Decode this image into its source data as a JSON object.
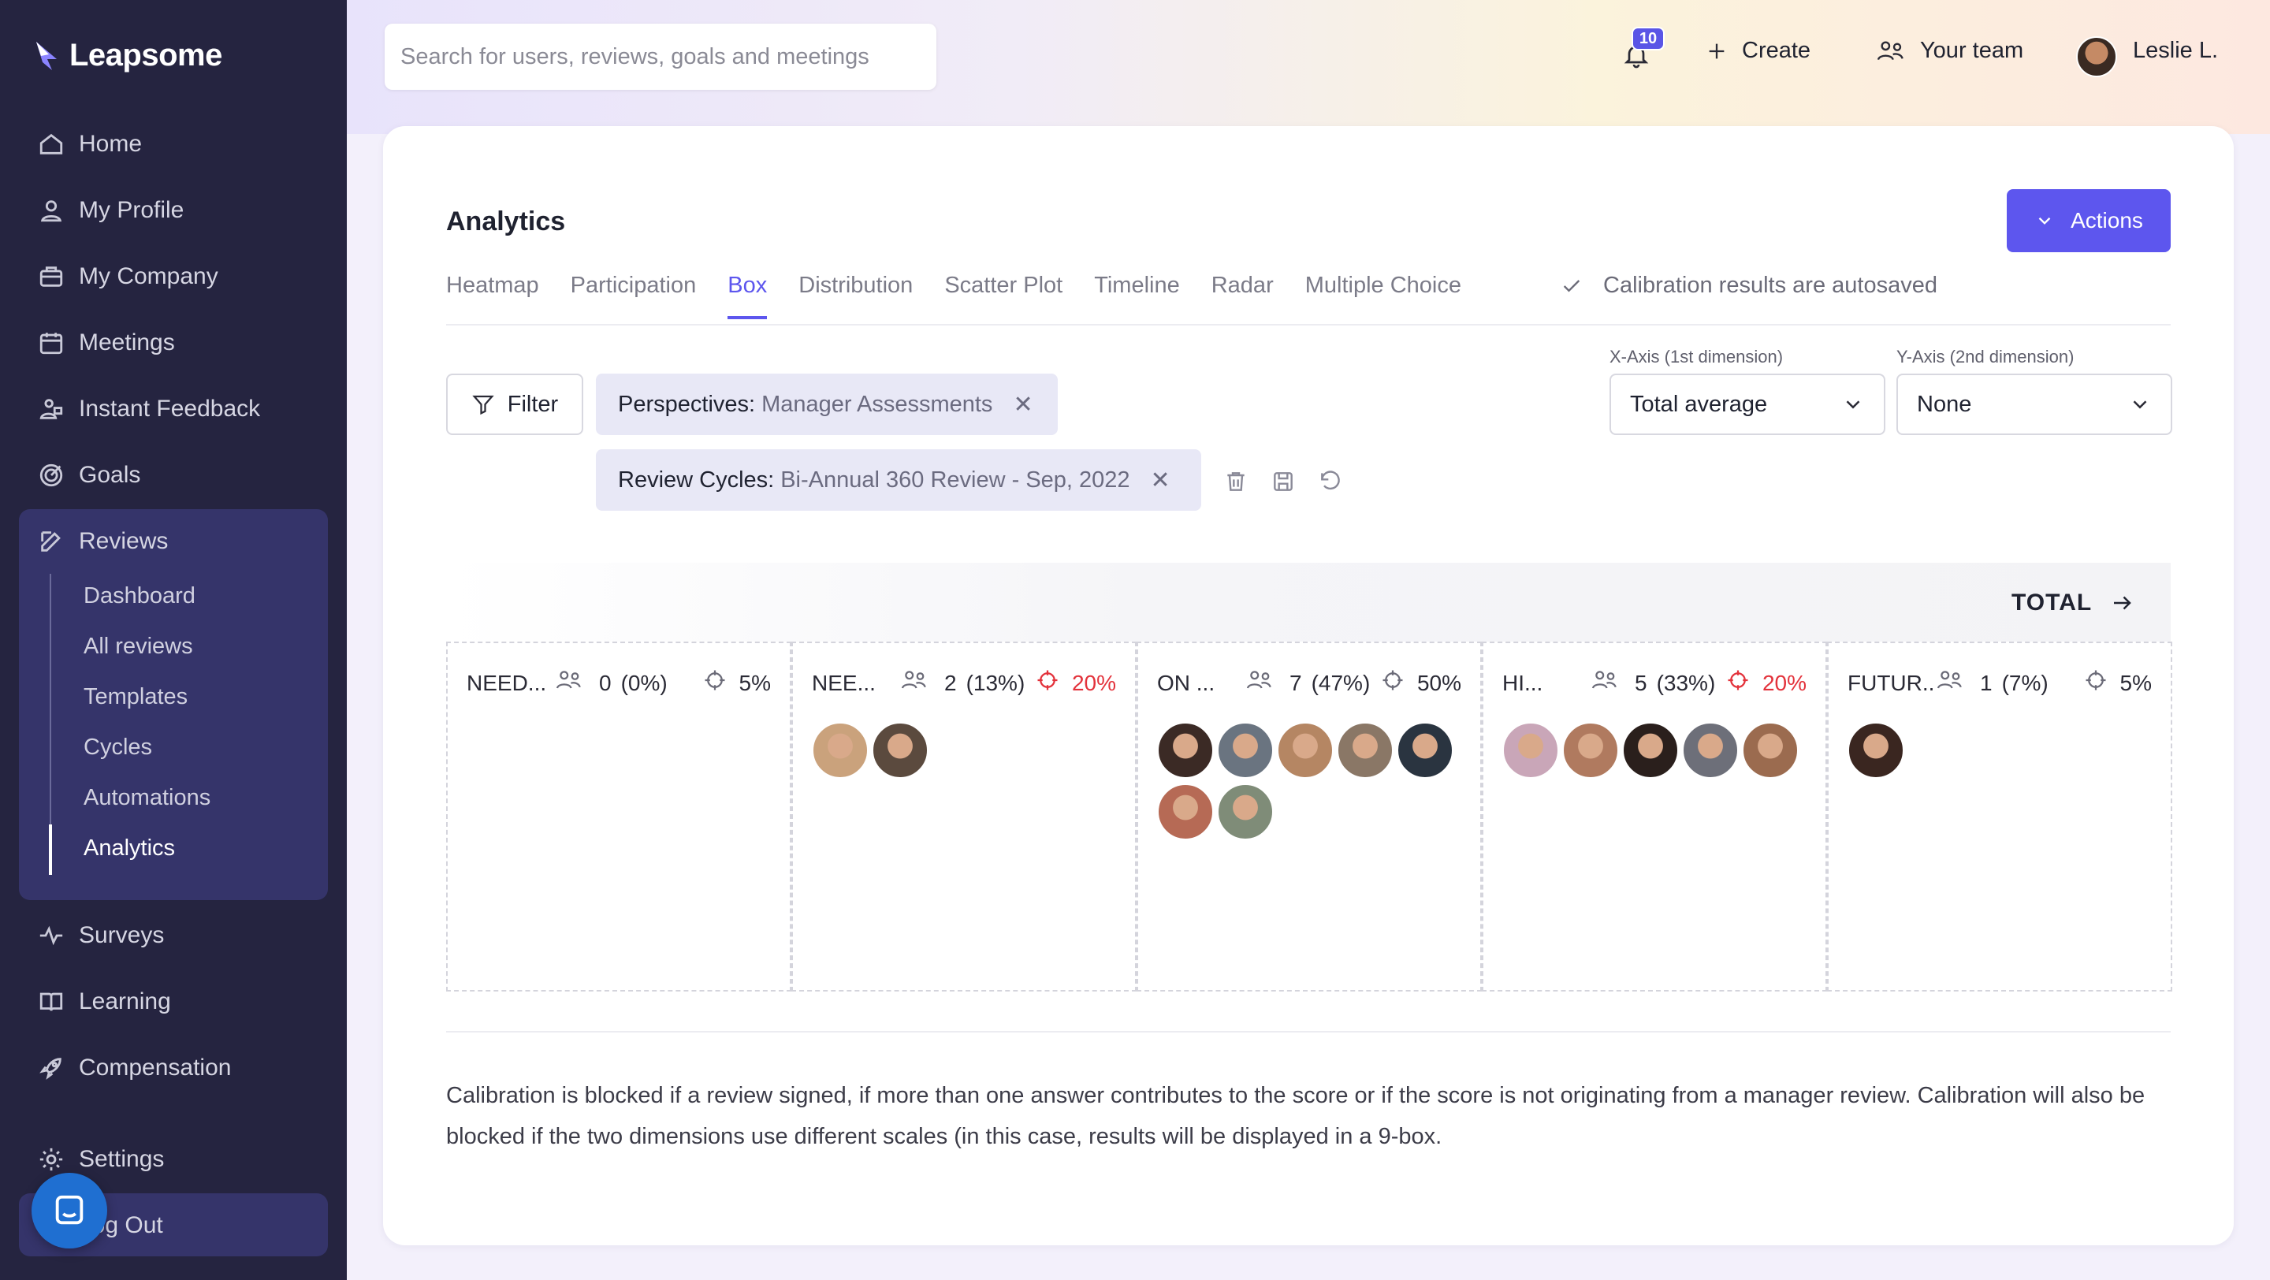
{
  "app": {
    "brand": "Leapsome"
  },
  "sidebar": {
    "items": [
      {
        "label": "Home",
        "icon": "home-icon"
      },
      {
        "label": "My Profile",
        "icon": "user-icon"
      },
      {
        "label": "My Company",
        "icon": "company-icon"
      },
      {
        "label": "Meetings",
        "icon": "calendar-icon"
      },
      {
        "label": "Instant Feedback",
        "icon": "feedback-icon"
      },
      {
        "label": "Goals",
        "icon": "target-icon"
      },
      {
        "label": "Reviews",
        "icon": "edit-icon"
      },
      {
        "label": "Surveys",
        "icon": "pulse-icon"
      },
      {
        "label": "Learning",
        "icon": "book-icon"
      },
      {
        "label": "Compensation",
        "icon": "rocket-icon"
      },
      {
        "label": "Settings",
        "icon": "gear-icon"
      },
      {
        "label": "Log Out",
        "icon": "logout-icon"
      }
    ],
    "reviews_sub": [
      "Dashboard",
      "All reviews",
      "Templates",
      "Cycles",
      "Automations",
      "Analytics"
    ],
    "active_sub": "Analytics"
  },
  "topbar": {
    "search_placeholder": "Search for users, reviews, goals and meetings",
    "notification_count": "10",
    "create_label": "Create",
    "team_label": "Your team",
    "user_name": "Leslie L."
  },
  "page": {
    "title": "Analytics",
    "actions_label": "Actions",
    "tabs": [
      "Heatmap",
      "Participation",
      "Box",
      "Distribution",
      "Scatter Plot",
      "Timeline",
      "Radar",
      "Multiple Choice"
    ],
    "active_tab": "Box",
    "autosave_text": "Calibration results are autosaved",
    "filter_label": "Filter",
    "chips": [
      {
        "key": "Perspectives:",
        "value": "Manager Assessments"
      },
      {
        "key": "Review Cycles:",
        "value": "Bi-Annual 360 Review - Sep, 2022"
      }
    ],
    "x_axis": {
      "label": "X-Axis (1st dimension)",
      "value": "Total average"
    },
    "y_axis": {
      "label": "Y-Axis (2nd dimension)",
      "value": "None"
    },
    "total_label": "TOTAL",
    "boxes": [
      {
        "label": "NEED...",
        "count": "0",
        "pct": "(0%)",
        "target": "5%",
        "target_red": false,
        "avatars": []
      },
      {
        "label": "NEE...",
        "count": "2",
        "pct": "(13%)",
        "target": "20%",
        "target_red": true,
        "avatars": [
          "#caa27c",
          "#5b4a3e"
        ]
      },
      {
        "label": "ON ...",
        "count": "7",
        "pct": "(47%)",
        "target": "50%",
        "target_red": false,
        "avatars": [
          "#3b2a25",
          "#6a7480",
          "#b58663",
          "#8a7766",
          "#2a3440",
          "#b66a55",
          "#7f8c78"
        ]
      },
      {
        "label": "HI...",
        "count": "5",
        "pct": "(33%)",
        "target": "20%",
        "target_red": true,
        "avatars": [
          "#c9a6b8",
          "#b07a5f",
          "#2a1f1c",
          "#6d6f79",
          "#9b6b4f"
        ]
      },
      {
        "label": "FUTUR...",
        "count": "1",
        "pct": "(7%)",
        "target": "5%",
        "target_red": false,
        "avatars": [
          "#3a2620"
        ]
      }
    ],
    "note": "Calibration is blocked if a review signed, if more than one answer contributes to the score or if the score is not originating from a manager review. Calibration will also be blocked if the two dimensions use different scales (in this case, results will be displayed in a 9-box."
  },
  "colors": {
    "accent": "#5d56ee",
    "sidebar": "#252440",
    "danger": "#e3323b"
  }
}
